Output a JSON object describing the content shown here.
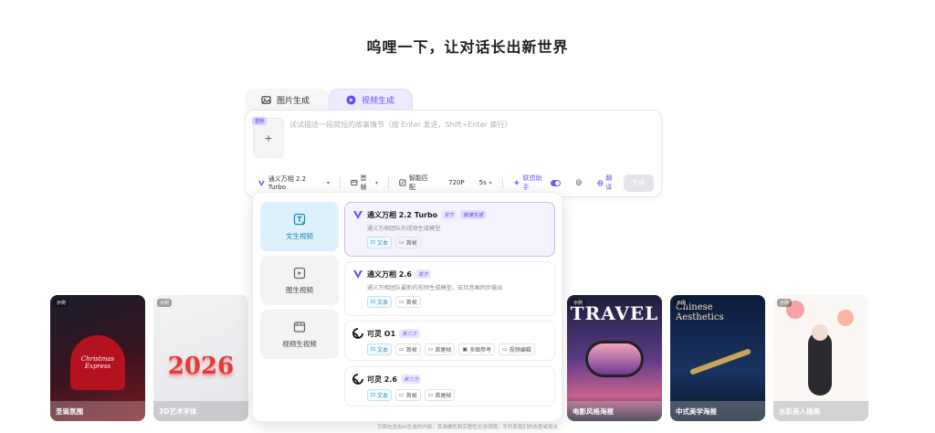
{
  "headline": "呜哩一下，让对话长出新世界",
  "tabs": [
    {
      "label": "图片生成",
      "icon": "image-icon"
    },
    {
      "label": "视频生成",
      "icon": "video-icon"
    }
  ],
  "composer": {
    "upload_badge": "首帧",
    "upload_plus": "+",
    "placeholder": "试试描述一段简短的故事情节（按 Enter 发送，Shift+Enter 换行）",
    "model_selector": "通义万相 2.2 Turbo",
    "frame_selector": "首帧",
    "smart_match": "智能匹配",
    "resolution": "720P",
    "duration": "5s",
    "assist_label": "联想助手",
    "at_symbol": "@",
    "translate_label": "翻译",
    "generate_label": "生成"
  },
  "dropdown": {
    "categories": [
      {
        "label": "文生视频",
        "active": true
      },
      {
        "label": "图生视频",
        "active": false
      },
      {
        "label": "视频生视频",
        "active": false
      }
    ],
    "models": [
      {
        "name": "通义万相 2.2 Turbo",
        "tags": [
          "官方",
          "极速生成"
        ],
        "desc": "通义万相团队的视频生成模型",
        "features": [
          "文本",
          "首帧"
        ],
        "active": true
      },
      {
        "name": "通义万相 2.6",
        "tags": [
          "官方"
        ],
        "desc": "通义万相团队最新的视频生成模型，支持音画同步输出",
        "features": [
          "文本",
          "首帧"
        ],
        "active": false
      },
      {
        "name": "可灵 O1",
        "tags": [
          "第三方"
        ],
        "desc": "",
        "features": [
          "文本",
          "首帧",
          "首尾帧",
          "多图参考",
          "视频编辑"
        ],
        "active": false
      },
      {
        "name": "可灵 2.6",
        "tags": [
          "第三方"
        ],
        "desc": "",
        "features": [
          "文本",
          "首帧",
          "首尾帧"
        ],
        "active": false
      }
    ]
  },
  "gallery": [
    {
      "caption": "圣诞氛围",
      "art": "Christmas Express"
    },
    {
      "caption": "3D艺术字体",
      "art": "2026"
    },
    {
      "caption": "电影风格海报",
      "art": "TRAVEL"
    },
    {
      "caption": "中式美学海报",
      "art": "Chinese Aesthetics"
    },
    {
      "caption": "水彩美人插画",
      "art": ""
    }
  ],
  "gallery_tag": "示例",
  "footer": "页面包含由AI生成的内容，其准确性和完整性无法保障，不代表我们的态度或观点",
  "colors": {
    "accent": "#6b4ef0",
    "category_active": "#dcf1fb"
  }
}
